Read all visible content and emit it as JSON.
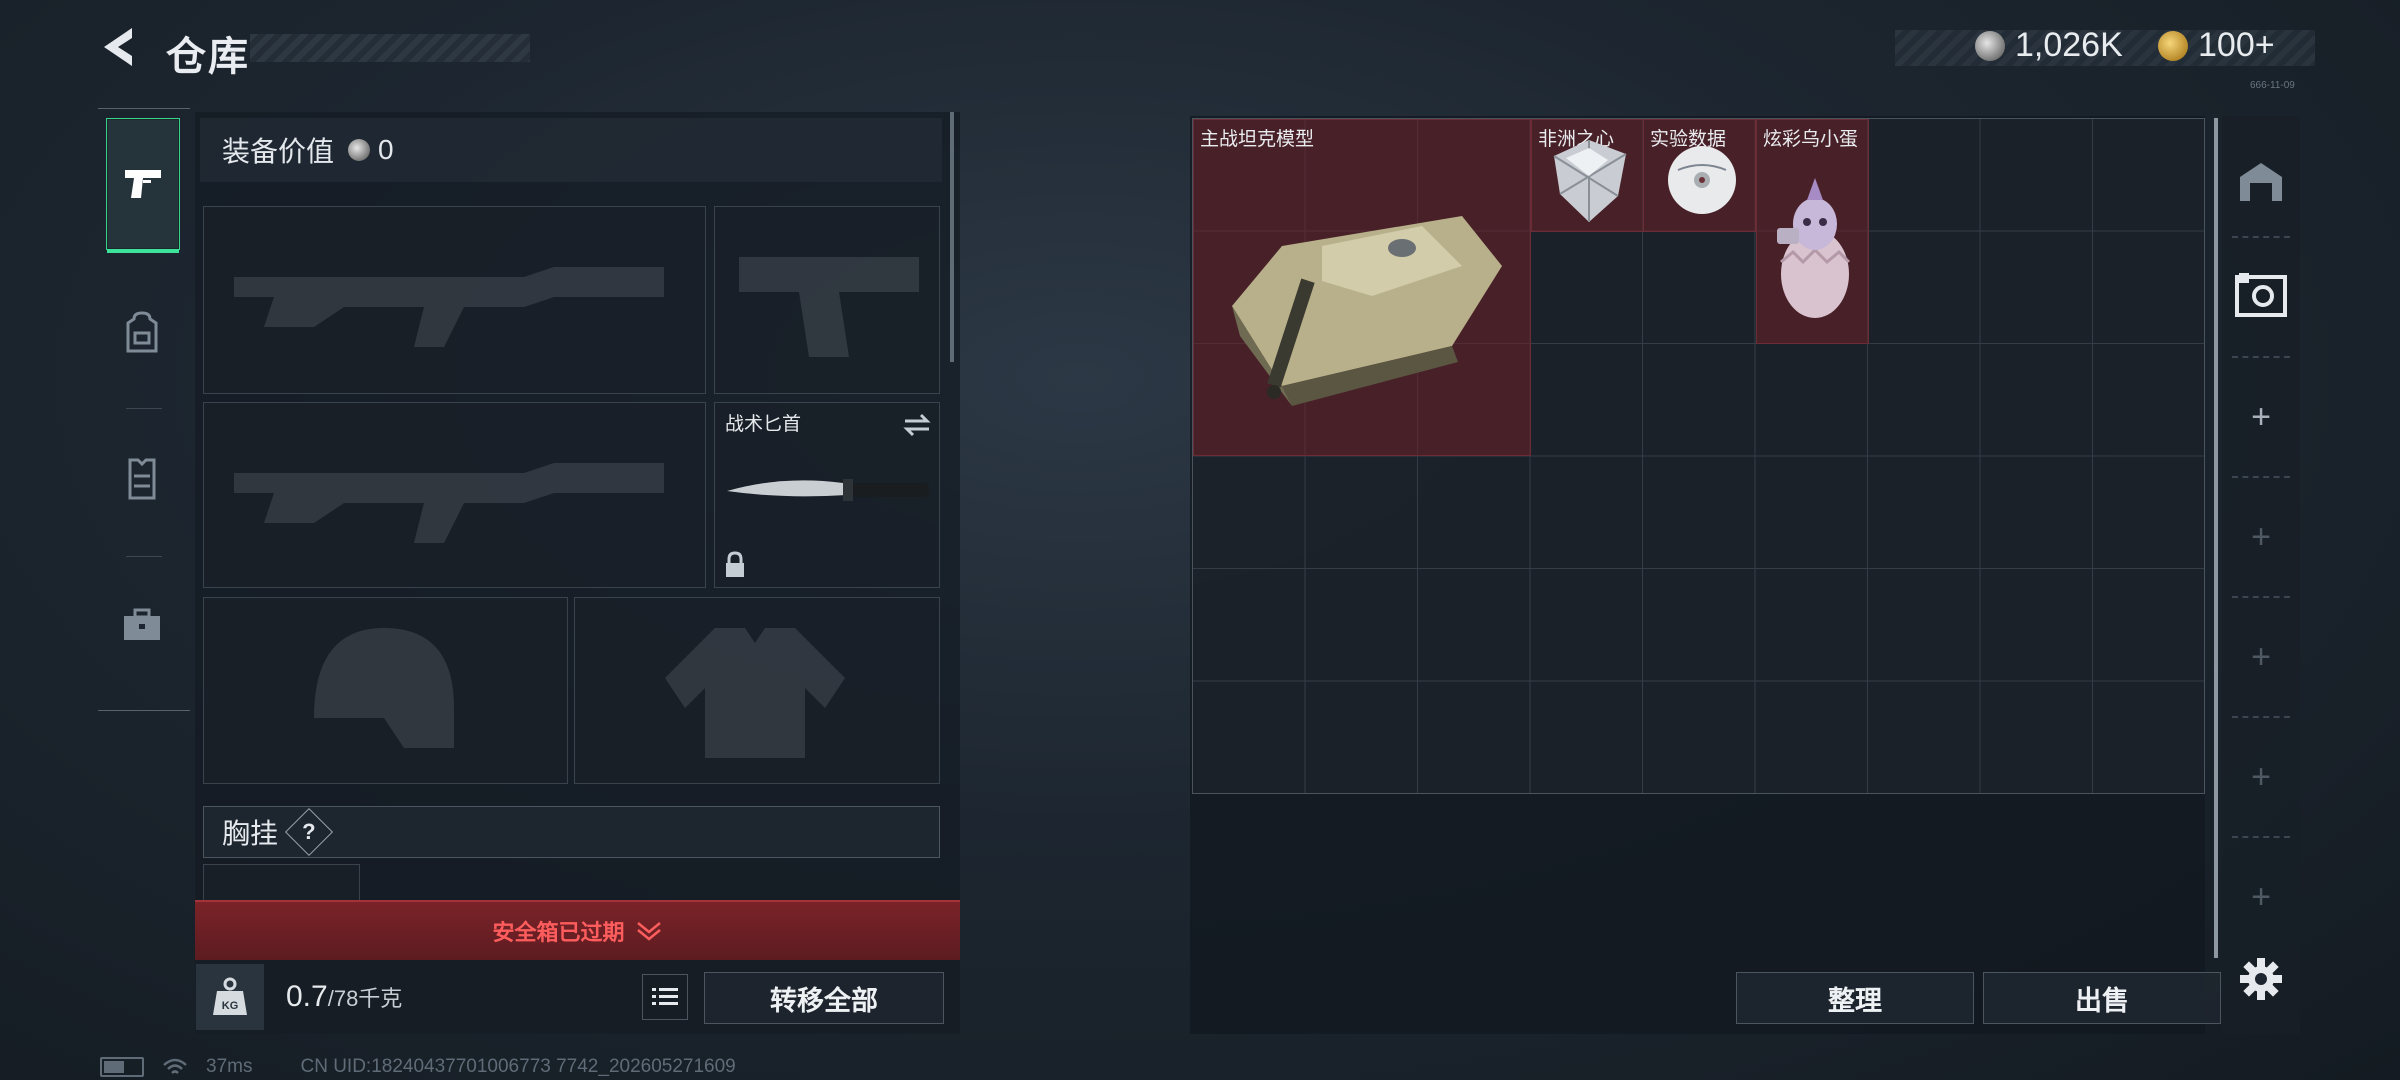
{
  "header": {
    "title": "仓库",
    "currencies": [
      {
        "icon": "silver-coin-icon",
        "value": "1,026K"
      },
      {
        "icon": "gold-coin-icon",
        "value": "100+"
      }
    ],
    "corner_text": "666-11-09"
  },
  "left_tabs": [
    {
      "icon": "pistol-icon",
      "selected": true
    },
    {
      "icon": "backpack-icon",
      "selected": false
    },
    {
      "icon": "vest-icon",
      "selected": false
    },
    {
      "icon": "briefcase-icon",
      "selected": false
    }
  ],
  "equipment": {
    "value_label": "装备价值",
    "value": "0",
    "knife_label": "战术匕首",
    "chest_rig_label": "胸挂",
    "chest_rig_help": "?",
    "safe_box_status": "安全箱已过期",
    "weight_current": "0.7",
    "weight_max": "/78千克",
    "weight_icon_text": "KG",
    "transfer_all_label": "转移全部"
  },
  "storage": {
    "items": [
      {
        "name": "主战坦克模型",
        "icon": "tank-model-icon"
      },
      {
        "name": "非洲之心",
        "icon": "diamond-icon"
      },
      {
        "name": "实验数据",
        "icon": "data-disc-icon"
      },
      {
        "name": "炫彩乌小蛋",
        "icon": "egg-figure-icon"
      }
    ],
    "sort_label": "整理",
    "sell_label": "出售"
  },
  "right_rail": [
    {
      "icon": "warehouse-icon"
    },
    {
      "icon": "storage-box-icon"
    },
    {
      "icon": "add-icon",
      "text": "+"
    },
    {
      "icon": "add-icon",
      "text": "+"
    },
    {
      "icon": "add-icon",
      "text": "+"
    },
    {
      "icon": "add-icon",
      "text": "+"
    },
    {
      "icon": "add-icon",
      "text": "+"
    },
    {
      "icon": "gear-icon"
    }
  ],
  "status_bar": {
    "ping": "37ms",
    "uid": "CN UID:18240437701006773 7742_202605271609"
  },
  "colors": {
    "accent_green": "#3de39b",
    "item_bg_red": "#6e2028",
    "warning_red": "#ff5d5d"
  }
}
